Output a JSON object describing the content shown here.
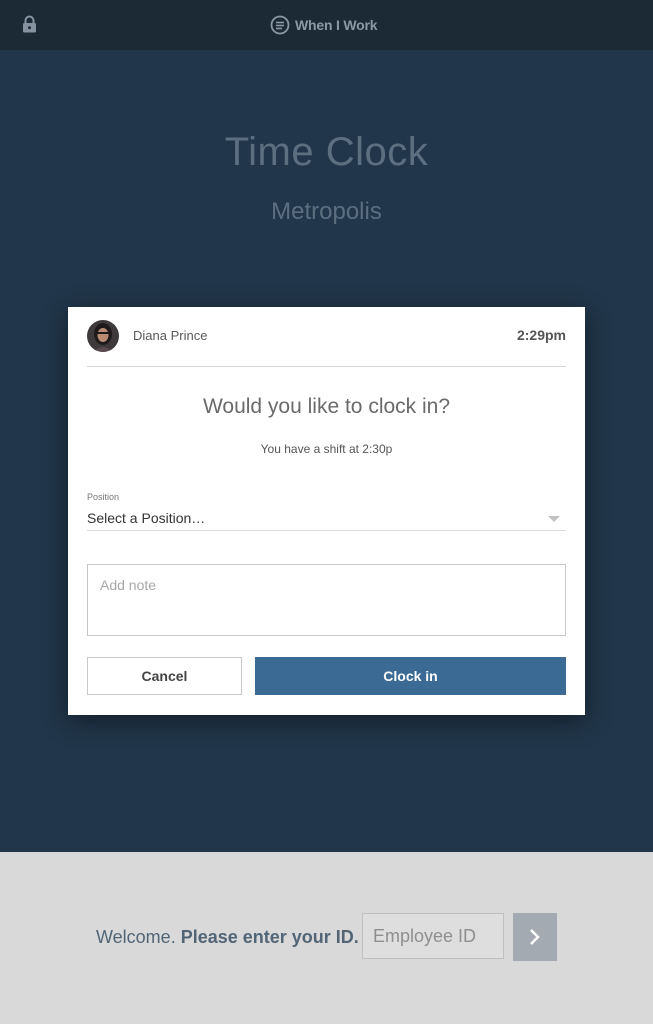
{
  "topbar": {
    "brand": "When I Work",
    "lock_icon": "lock-icon",
    "logo_icon": "menu-circle-icon"
  },
  "hero": {
    "title": "Time Clock",
    "location": "Metropolis"
  },
  "modal": {
    "user_name": "Diana Prince",
    "time": "2:29pm",
    "question": "Would you like to clock in?",
    "shift_note": "You have a shift at 2:30p",
    "position_label": "Position",
    "position_value": "Select a Position…",
    "note_placeholder": "Add note",
    "cancel_label": "Cancel",
    "clockin_label": "Clock in"
  },
  "bottom": {
    "welcome": "Welcome.",
    "prompt": "Please enter your ID.",
    "employee_placeholder": "Employee ID"
  },
  "colors": {
    "topbar": "#1c2a36",
    "hero": "#21364a",
    "accent": "#3b6b95",
    "bottom": "#d9d9d9"
  }
}
